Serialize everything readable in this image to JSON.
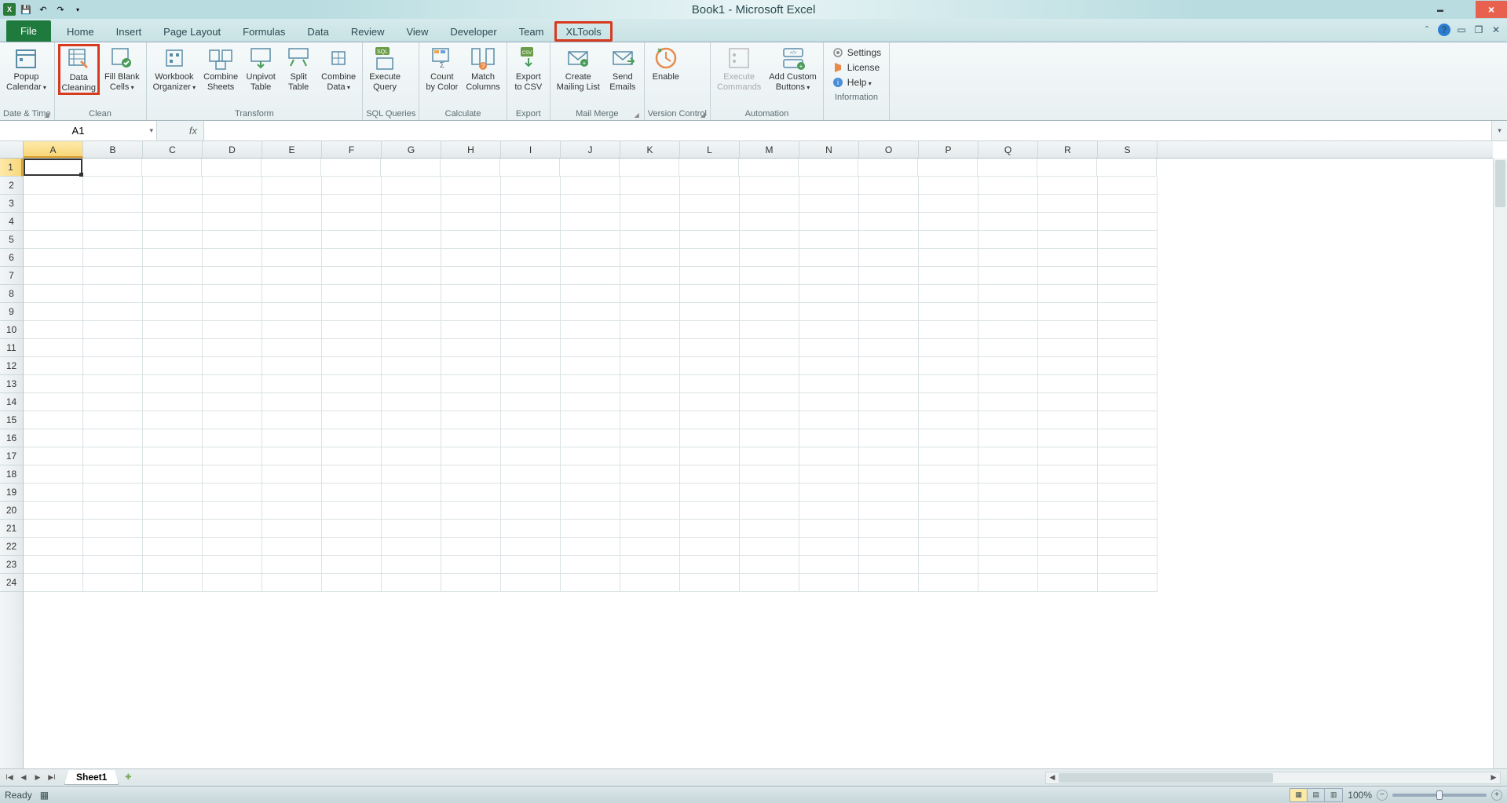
{
  "title": "Book1 - Microsoft Excel",
  "tabs": {
    "file": "File",
    "list": [
      "Home",
      "Insert",
      "Page Layout",
      "Formulas",
      "Data",
      "Review",
      "View",
      "Developer",
      "Team",
      "XLTools"
    ],
    "active": "XLTools",
    "highlighted": "XLTools"
  },
  "ribbon": {
    "groups": [
      {
        "name": "Date & Time",
        "launcher": true,
        "buttons": [
          {
            "label": "Popup\nCalendar",
            "id": "popup-calendar",
            "drop": true
          }
        ]
      },
      {
        "name": "Clean",
        "buttons": [
          {
            "label": "Data\nCleaning",
            "id": "data-cleaning",
            "highlight": true
          },
          {
            "label": "Fill Blank\nCells",
            "id": "fill-blank-cells",
            "drop": true
          }
        ]
      },
      {
        "name": "Transform",
        "buttons": [
          {
            "label": "Workbook\nOrganizer",
            "id": "workbook-organizer",
            "drop": true
          },
          {
            "label": "Combine\nSheets",
            "id": "combine-sheets"
          },
          {
            "label": "Unpivot\nTable",
            "id": "unpivot-table"
          },
          {
            "label": "Split\nTable",
            "id": "split-table"
          },
          {
            "label": "Combine\nData",
            "id": "combine-data",
            "drop": true
          }
        ]
      },
      {
        "name": "SQL Queries",
        "buttons": [
          {
            "label": "Execute\nQuery",
            "id": "execute-query"
          }
        ]
      },
      {
        "name": "Calculate",
        "buttons": [
          {
            "label": "Count\nby Color",
            "id": "count-by-color"
          },
          {
            "label": "Match\nColumns",
            "id": "match-columns"
          }
        ]
      },
      {
        "name": "Export",
        "buttons": [
          {
            "label": "Export\nto CSV",
            "id": "export-to-csv"
          }
        ]
      },
      {
        "name": "Mail Merge",
        "launcher": true,
        "buttons": [
          {
            "label": "Create\nMailing List",
            "id": "create-mailing-list"
          },
          {
            "label": "Send\nEmails",
            "id": "send-emails"
          }
        ]
      },
      {
        "name": "Version Control",
        "launcher": true,
        "buttons": [
          {
            "label": "Enable",
            "id": "vc-enable"
          }
        ]
      },
      {
        "name": "Automation",
        "buttons": [
          {
            "label": "Execute\nCommands",
            "id": "execute-commands",
            "disabled": true
          },
          {
            "label": "Add Custom\nButtons",
            "id": "add-custom-buttons",
            "drop": true
          }
        ]
      },
      {
        "name": "Information",
        "vertical": true,
        "buttons": [
          {
            "label": "Settings",
            "id": "settings"
          },
          {
            "label": "License",
            "id": "license"
          },
          {
            "label": "Help",
            "id": "help",
            "drop": true
          }
        ]
      }
    ]
  },
  "namebox": "A1",
  "fx_label": "fx",
  "formula": "",
  "columns": [
    "A",
    "B",
    "C",
    "D",
    "E",
    "F",
    "G",
    "H",
    "I",
    "J",
    "K",
    "L",
    "M",
    "N",
    "O",
    "P",
    "Q",
    "R",
    "S"
  ],
  "rows": [
    1,
    2,
    3,
    4,
    5,
    6,
    7,
    8,
    9,
    10,
    11,
    12,
    13,
    14,
    15,
    16,
    17,
    18,
    19,
    20,
    21,
    22,
    23,
    24
  ],
  "active_cell": {
    "col": "A",
    "row": 1
  },
  "sheet_tabs": {
    "active": "Sheet1",
    "list": [
      "Sheet1"
    ]
  },
  "status": {
    "left": "Ready",
    "zoom": "100%"
  }
}
